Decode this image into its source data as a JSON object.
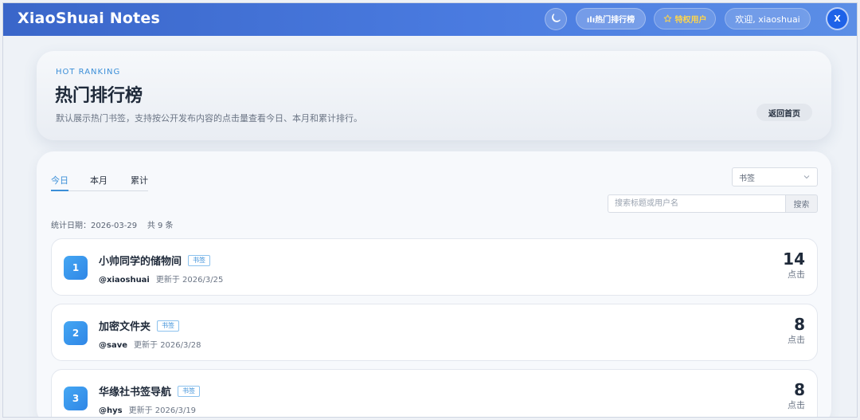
{
  "header": {
    "brand": "XiaoShuai Notes",
    "theme_icon": "moon-icon",
    "rank_label": "ılı热门排行榜",
    "vip_label": "特权用户",
    "vip_icon": "star-icon",
    "welcome": "欢迎, xiaoshuai",
    "avatar_initial": "X"
  },
  "hero": {
    "eyebrow": "HOT RANKING",
    "title": "热门排行榜",
    "description": "默认展示热门书签，支持按公开发布内容的点击量查看今日、本月和累计排行。",
    "back_label": "返回首页"
  },
  "filters": {
    "tabs": [
      {
        "label": "今日",
        "active": true
      },
      {
        "label": "本月",
        "active": false
      },
      {
        "label": "累计",
        "active": false
      }
    ],
    "type_selected": "书签",
    "search_placeholder": "搜索标题或用户名",
    "search_button": "搜索",
    "stats": "统计日期：2026-03-29    共 9 条"
  },
  "ranking": [
    {
      "rank": "1",
      "title": "小帅同学的储物间",
      "tag": "书签",
      "user": "@xiaoshuai",
      "updated": "更新于 2026/3/25",
      "clicks": "14",
      "clicks_label": "点击"
    },
    {
      "rank": "2",
      "title": "加密文件夹",
      "tag": "书签",
      "user": "@save",
      "updated": "更新于 2026/3/28",
      "clicks": "8",
      "clicks_label": "点击"
    },
    {
      "rank": "3",
      "title": "华缘社书签导航",
      "tag": "书签",
      "user": "@hys",
      "updated": "更新于 2026/3/19",
      "clicks": "8",
      "clicks_label": "点击"
    }
  ],
  "colors": {
    "header_start": "#3a66c9",
    "accent": "#3b8fd8",
    "vip": "#ffd54a",
    "avatar": "#1e62e8"
  }
}
